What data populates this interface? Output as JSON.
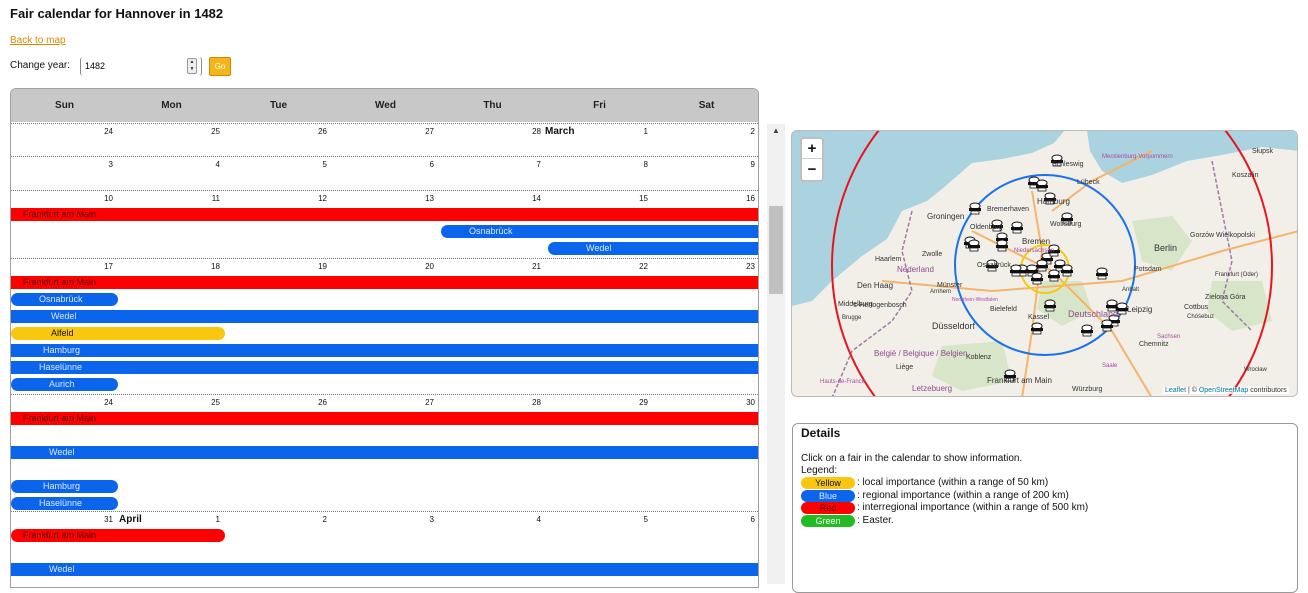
{
  "title": "Fair calendar for Hannover in 1482",
  "back_link": "Back to map",
  "year_control": {
    "label": "Change year:",
    "value": "1482",
    "go_label": "Go"
  },
  "calendar": {
    "days_of_week": [
      "Sun",
      "Mon",
      "Tue",
      "Wed",
      "Thu",
      "Fri",
      "Sat"
    ],
    "weeks": [
      {
        "days": [
          "24",
          "25",
          "26",
          "27",
          "28",
          "1",
          "2"
        ],
        "month_label": "March",
        "bars": []
      },
      {
        "days": [
          "3",
          "4",
          "5",
          "6",
          "7",
          "8",
          "9"
        ],
        "bars": []
      },
      {
        "days": [
          "10",
          "11",
          "12",
          "13",
          "14",
          "15",
          "16"
        ],
        "bars": [
          {
            "label": "Frankfurt am Main",
            "color": "red"
          },
          {
            "label": "Osnabrück",
            "color": "blue"
          },
          {
            "label": "Wedel",
            "color": "blue"
          }
        ]
      },
      {
        "days": [
          "17",
          "18",
          "19",
          "20",
          "21",
          "22",
          "23"
        ],
        "bars": [
          {
            "label": "Frankfurt am Main",
            "color": "red"
          },
          {
            "label": "Osnabrück",
            "color": "blue"
          },
          {
            "label": "Wedel",
            "color": "blue"
          },
          {
            "label": "Alfeld",
            "color": "yellow"
          },
          {
            "label": "Hamburg",
            "color": "blue"
          },
          {
            "label": "Haselünne",
            "color": "blue"
          },
          {
            "label": "Aurich",
            "color": "blue"
          }
        ]
      },
      {
        "days": [
          "24",
          "25",
          "26",
          "27",
          "28",
          "29",
          "30"
        ],
        "bars": [
          {
            "label": "Frankfurt am Main",
            "color": "red"
          },
          {
            "label": "Wedel",
            "color": "blue"
          },
          {
            "label": "Hamburg",
            "color": "blue"
          },
          {
            "label": "Haselünne",
            "color": "blue"
          }
        ]
      },
      {
        "days": [
          "31",
          "1",
          "2",
          "3",
          "4",
          "5",
          "6"
        ],
        "month_label": "April",
        "bars": [
          {
            "label": "Frankfurt am Main",
            "color": "red"
          },
          {
            "label": "Wedel",
            "color": "blue"
          }
        ]
      }
    ]
  },
  "map": {
    "zoom_in": "+",
    "zoom_out": "−",
    "attribution_leaflet": "Leaflet",
    "attribution_sep": " | © ",
    "attribution_osm": "OpenStreetMap",
    "attribution_tail": " contributors",
    "place_labels": [
      "Schleswig",
      "Lübeck",
      "Mecklenburg-Vorpommern",
      "Słupsk",
      "Koszalin",
      "Groningen",
      "Bremerhaven",
      "Hamburg",
      "Oldenburg",
      "Bremen",
      "Zwolle",
      "Niedersachsen",
      "Wolfsburg",
      "Berlin",
      "Gorzów Wielkopolski",
      "Haarlem",
      "Nederland",
      "Osnabrück",
      "Bielefeld",
      "Potsdam",
      "Den Haag",
      "Münster",
      "Anhalt",
      "Frankfurt (Oder)",
      "Zielona Góra",
      "Middelburg",
      "'s-Hertogenbosch",
      "Arnhem",
      "Cottbus",
      "Chóśebuz",
      "Brugge",
      "Düsseldorf",
      "Kassel",
      "Deutschland",
      "Leipzig",
      "België / Belgique / Belgien",
      "Sachsen",
      "Chemnitz",
      "Koblenz",
      "Frankfurt am Main",
      "Würzburg",
      "Letzebuerg",
      "Hauts-de-France",
      "Liège",
      "Nordrhein-Westfalen",
      "Saale",
      "Wrocław"
    ],
    "colors": {
      "local": "#f9c80e",
      "regional": "#1a73e8",
      "interregional": "#e8141b"
    }
  },
  "details": {
    "title": "Details",
    "info": "Click on a fair in the calendar to show information.",
    "legend_heading": "Legend:",
    "legend": [
      {
        "label": "Yellow",
        "desc": ": local importance (within a range of 50 km)",
        "color": "#f9c80e",
        "text_color": "#111111"
      },
      {
        "label": "Blue",
        "desc": ": regional importance (within a range of 200 km)",
        "color": "#0a64ec",
        "text_color": "#dfe9ff"
      },
      {
        "label": "Red",
        "desc": ": interregional importance (within a range of 500 km)",
        "color": "#ff0000",
        "text_color": "#550000"
      },
      {
        "label": "Green",
        "desc": ": Easter.",
        "color": "#22bb22",
        "text_color": "#ffffff"
      }
    ]
  }
}
